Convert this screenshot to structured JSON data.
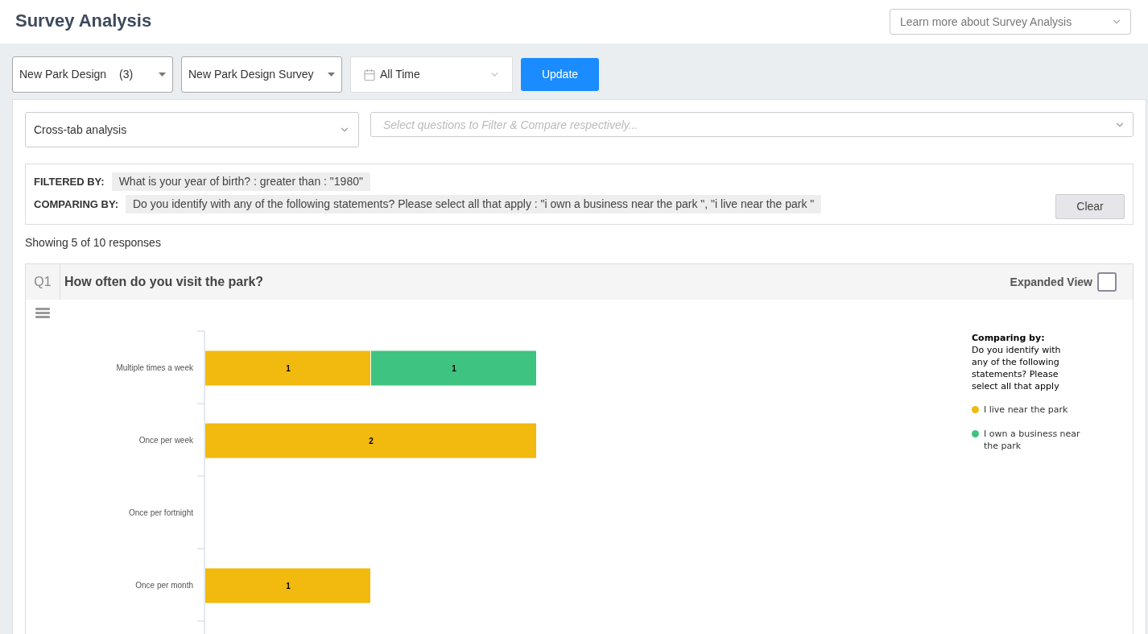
{
  "header": {
    "title": "Survey Analysis",
    "help_dropdown": "Learn more about Survey Analysis"
  },
  "toolbar": {
    "project_select": {
      "value": "New Park Design",
      "count": "(3)"
    },
    "survey_select": "New Park Design Survey",
    "date_range": "All Time",
    "update_button": "Update"
  },
  "analysis": {
    "mode_select": "Cross-tab analysis",
    "question_picker": {
      "placeholder": "Select questions to Filter & Compare respectively..."
    }
  },
  "filters": {
    "rows": [
      {
        "label": "FILTERED BY:",
        "value": "What is your year of birth? : greater than : \"1980\""
      },
      {
        "label": "COMPARING BY:",
        "value": "Do you identify with any of the following statements? Please select all that apply : \"i own a business near the park \", \"i live near the park \""
      }
    ],
    "clear_button": "Clear"
  },
  "summary": "Showing 5 of 10 responses",
  "questions": [
    {
      "number": "Q1",
      "title": "How often do you visit the park?",
      "expanded_view": {
        "label": "Expanded View",
        "checked": false
      },
      "legend": {
        "heading": "Comparing by:",
        "text": "Do you identify with any of the following statements? Please select all that apply"
      },
      "chart_data": {
        "type": "bar",
        "orientation": "horizontal",
        "stacked": true,
        "data_labels": true,
        "categories": [
          "Multiple times a week",
          "Once per week",
          "Once per fortnight",
          "Once per month"
        ],
        "series": [
          {
            "name": "I live near the park",
            "color": "#f2b90f",
            "values": [
              1,
              2,
              null,
              1
            ]
          },
          {
            "name": "I own a business near the park",
            "color": "#3fc380",
            "values": [
              1,
              null,
              null,
              null
            ]
          }
        ]
      }
    }
  ]
}
